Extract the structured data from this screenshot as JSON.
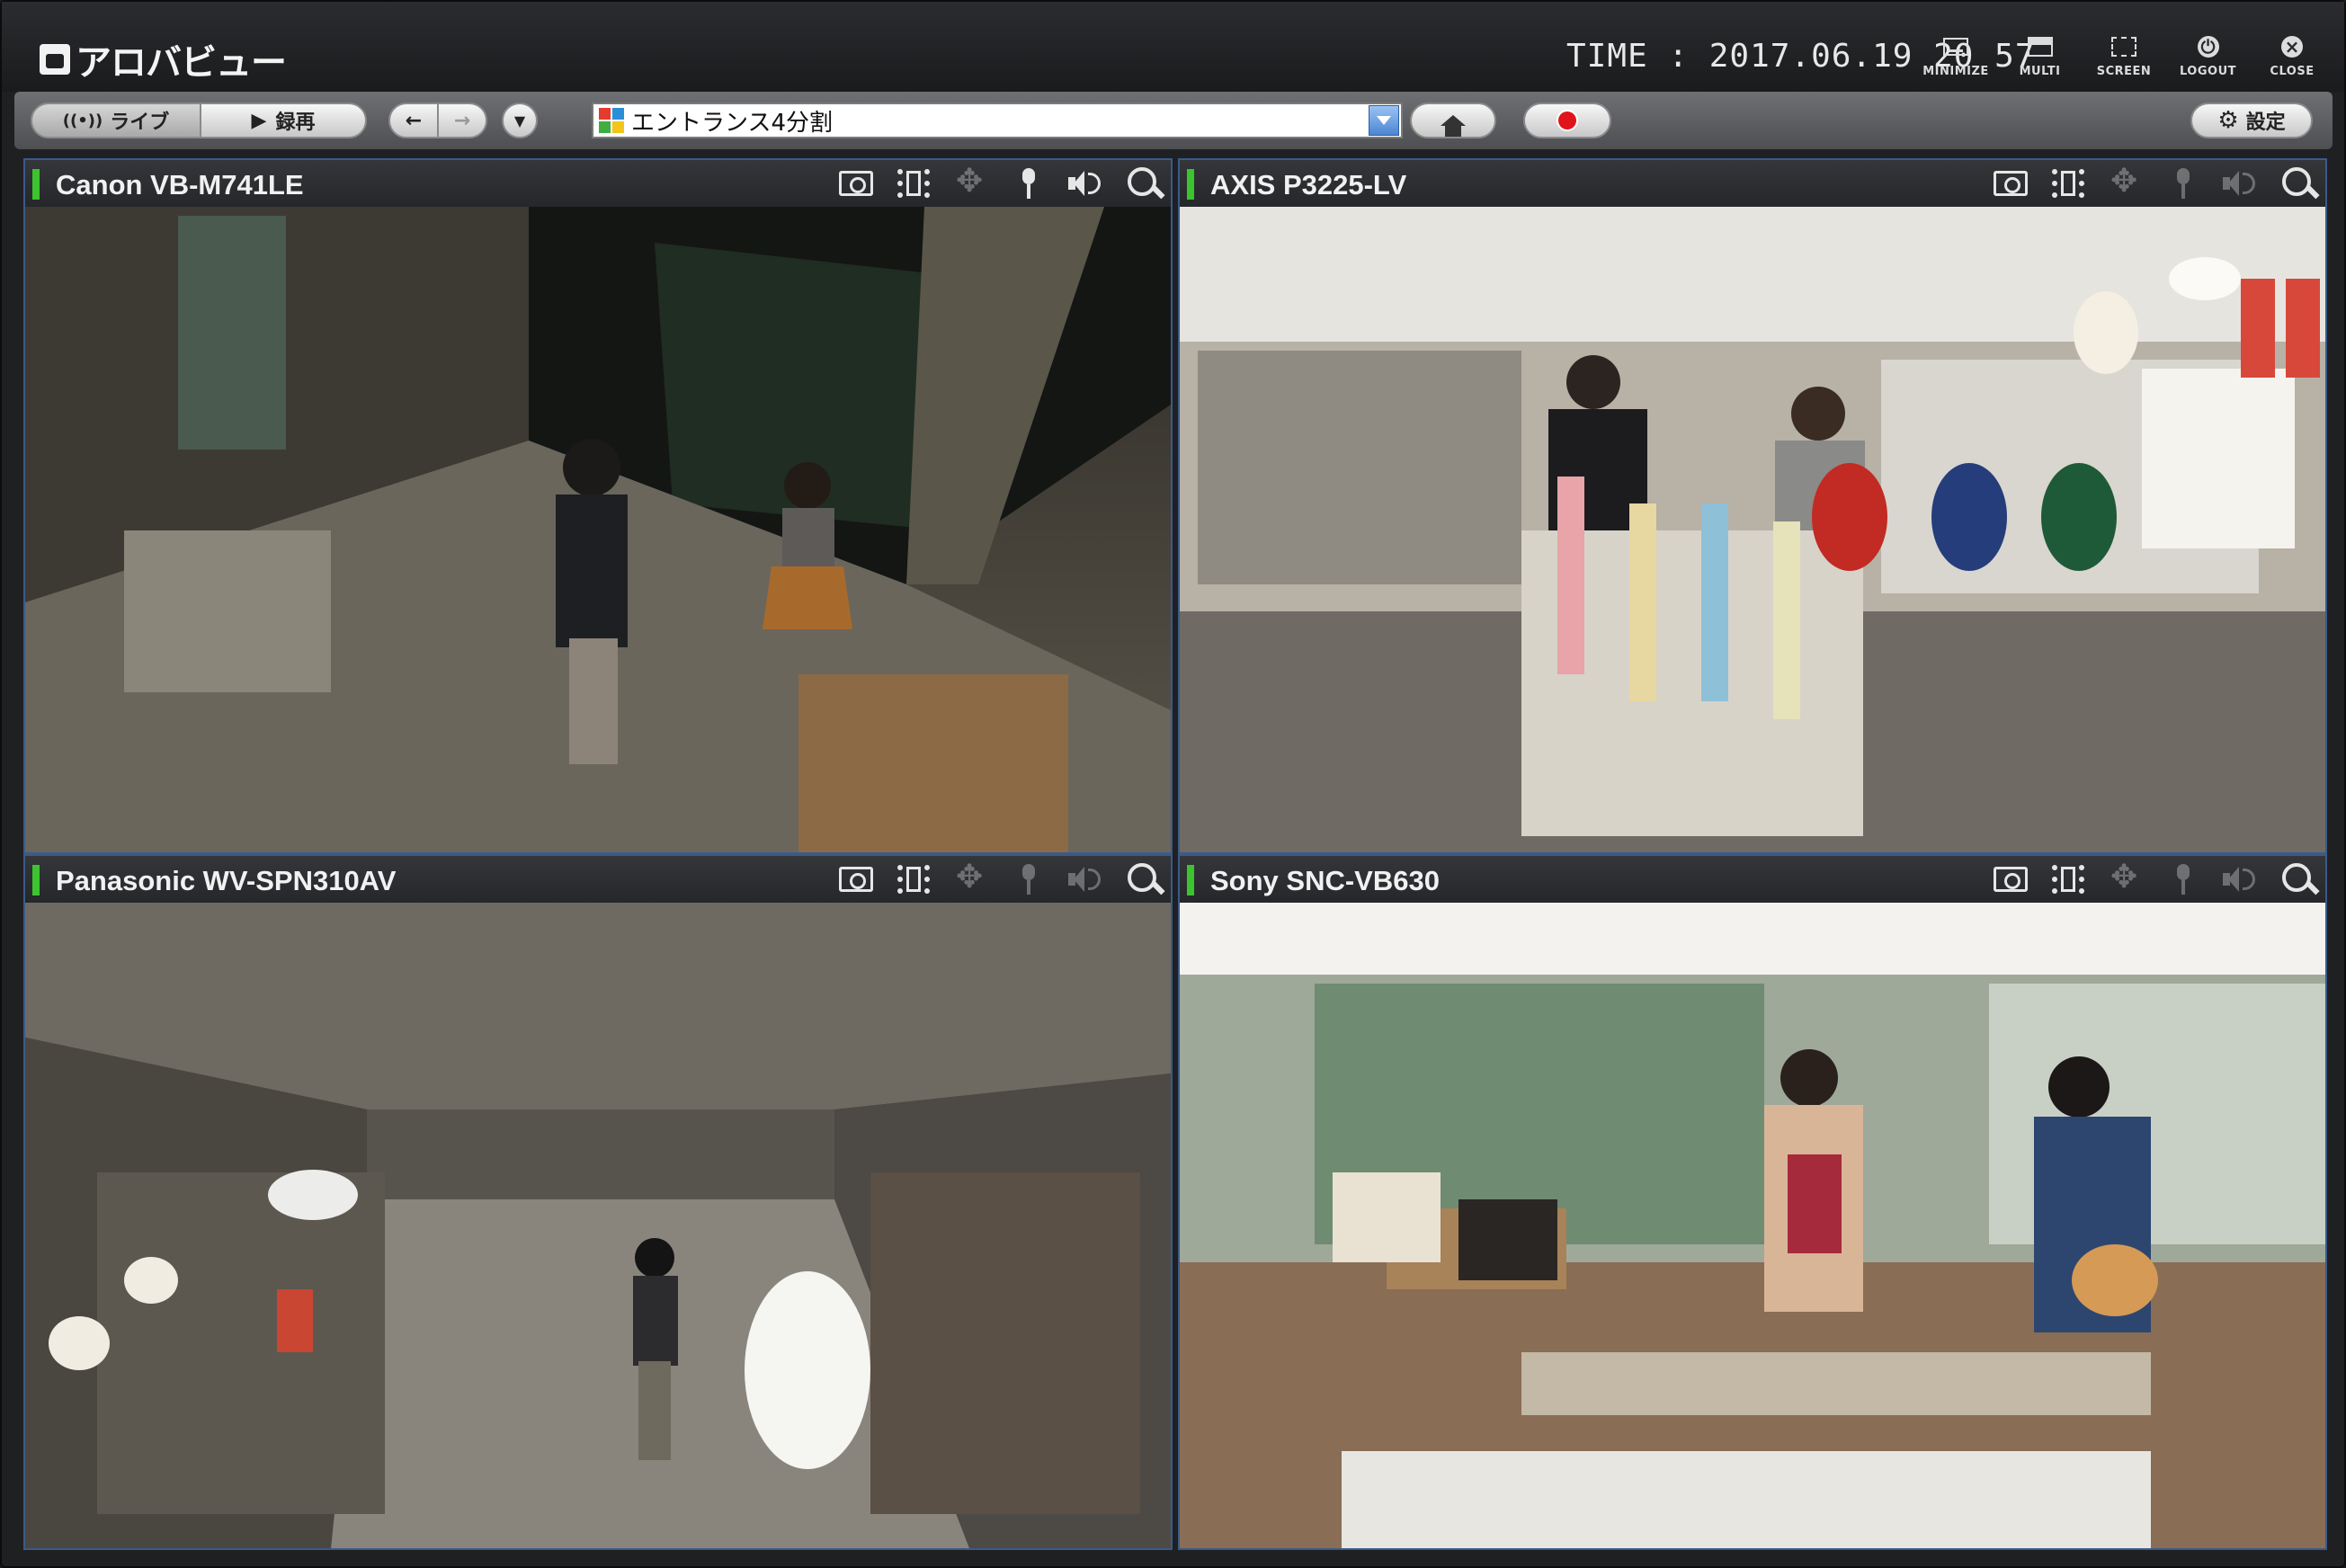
{
  "app": {
    "logo_text": "アロバビュー"
  },
  "clock": {
    "text": "TIME : 2017.06.19 20 57"
  },
  "window_buttons": [
    {
      "label": "MINIMIZE",
      "icon": "minimize-icon"
    },
    {
      "label": "MULTI",
      "icon": "multi-icon"
    },
    {
      "label": "SCREEN",
      "icon": "screen-icon"
    },
    {
      "label": "LOGOUT",
      "icon": "logout-icon"
    },
    {
      "label": "CLOSE",
      "icon": "close-icon"
    }
  ],
  "toolbar": {
    "live_label": "ライブ",
    "playback_label": "録再",
    "layout_value": "エントランス4分割",
    "settings_label": "設定"
  },
  "cameras": [
    {
      "title": "Canon VB-M741LE"
    },
    {
      "title": "AXIS P3225-LV"
    },
    {
      "title": "Panasonic WV-SPN310AV"
    },
    {
      "title": "Sony SNC-VB630"
    }
  ],
  "colors": {
    "active_indicator": "#3cc42f",
    "pane_border": "#3b5a8a",
    "record": "#e0141a"
  }
}
